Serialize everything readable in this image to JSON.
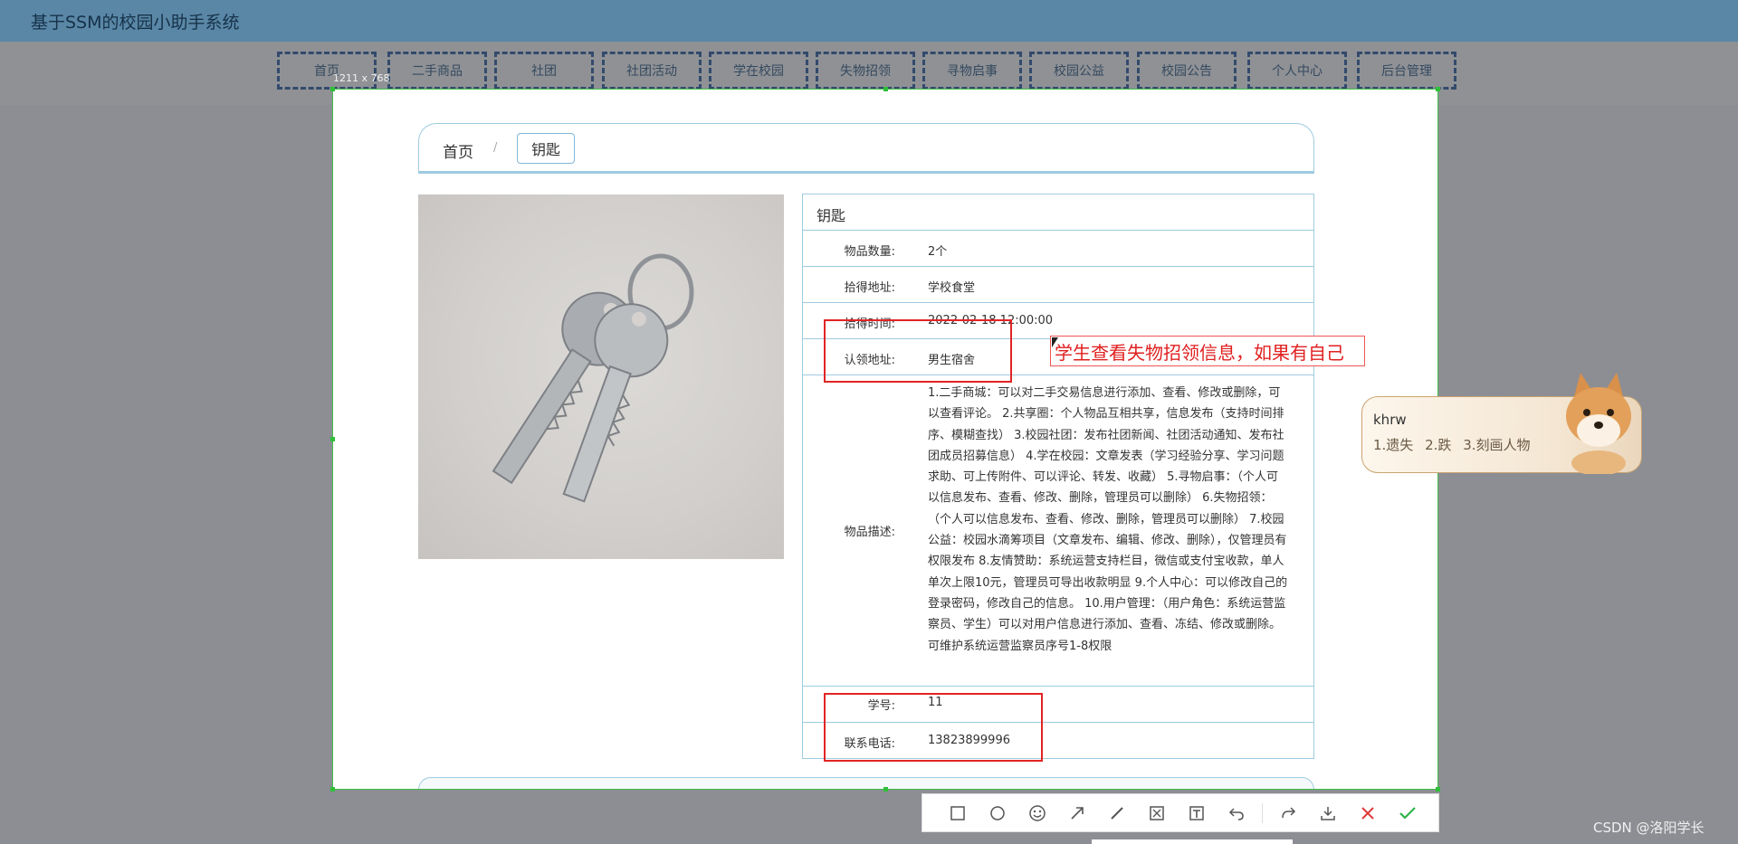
{
  "app": {
    "title": "基于SSM的校园小助手系统"
  },
  "nav": {
    "items": [
      {
        "label": "首页"
      },
      {
        "label": "二手商品"
      },
      {
        "label": "社团"
      },
      {
        "label": "社团活动"
      },
      {
        "label": "学在校园"
      },
      {
        "label": "失物招领"
      },
      {
        "label": "寻物启事"
      },
      {
        "label": "校园公益"
      },
      {
        "label": "校园公告"
      },
      {
        "label": "个人中心"
      },
      {
        "label": "后台管理"
      }
    ]
  },
  "screenshot_tool": {
    "size_label": "1211 x 768"
  },
  "breadcrumb": {
    "home": "首页",
    "separator": "/",
    "current": "钥匙"
  },
  "detail": {
    "title": "钥匙",
    "rows": [
      {
        "label": "物品数量:",
        "value": "2个"
      },
      {
        "label": "拾得地址:",
        "value": "学校食堂"
      },
      {
        "label": "拾得时间:",
        "value": "2022-02-18 12:00:00"
      },
      {
        "label": "认领地址:",
        "value": "男生宿舍"
      },
      {
        "label": "物品描述:",
        "value": "1.二手商城：可以对二手交易信息进行添加、查看、修改或删除，可以查看评论。 2.共享圈：个人物品互相共享，信息发布（支持时间排序、模糊查找） 3.校园社团：发布社团新闻、社团活动通知、发布社团成员招募信息） 4.学在校园：文章发表（学习经验分享、学习问题求助、可上传附件、可以评论、转发、收藏） 5.寻物启事：（个人可以信息发布、查看、修改、删除，管理员可以删除） 6.失物招领：（个人可以信息发布、查看、修改、删除，管理员可以删除） 7.校园公益：校园水滴筹项目（文章发布、编辑、修改、删除），仅管理员有权限发布 8.友情赞助：系统运营支持栏目，微信或支付宝收款，单人单次上限10元，管理员可导出收款明显 9.个人中心：可以修改自己的登录密码，修改自己的信息。 10.用户管理：（用户角色：系统运营监察员、学生）可以对用户信息进行添加、查看、冻结、修改或删除。 可维护系统运营监察员序号1-8权限"
      },
      {
        "label": "学号:",
        "value": "11"
      },
      {
        "label": "联系电话:",
        "value": "13823899996"
      }
    ]
  },
  "annotation": {
    "text": "学生查看失物招领信息，如果有自己"
  },
  "ime": {
    "input": "khrw",
    "candidates": [
      "1.遗失",
      "2.跌",
      "3.刻画人物"
    ]
  },
  "toolbar": {
    "icons": [
      "rectangle-icon",
      "ellipse-icon",
      "emoji-icon",
      "arrow-icon",
      "pen-icon",
      "mosaic-icon",
      "text-icon",
      "undo-icon",
      "share-icon",
      "download-icon",
      "cancel-icon",
      "confirm-icon"
    ]
  },
  "watermark": {
    "text": "CSDN @洛阳学长"
  },
  "colors": {
    "accent_border": "#9ecbe0",
    "annotation_red": "#e22424",
    "topbar": "#5a87a6",
    "selection_green": "#3fbf4a"
  }
}
